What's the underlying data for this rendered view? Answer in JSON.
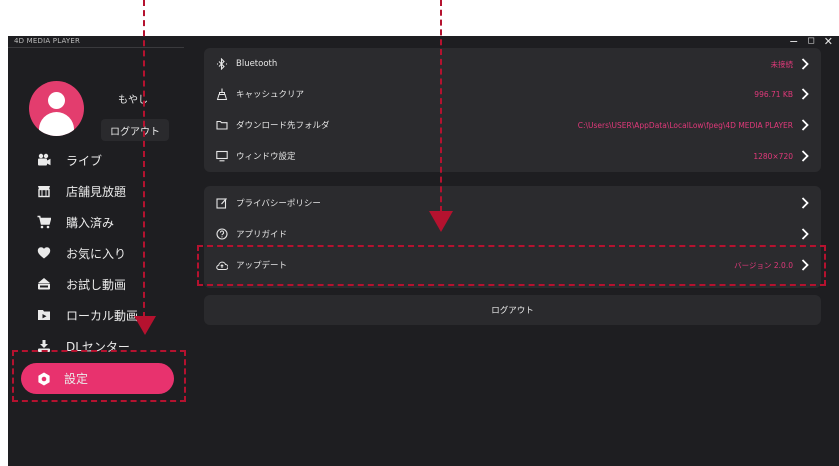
{
  "app": {
    "title": "4D MEDIA PLAYER"
  },
  "window_controls": {
    "minimize": "−",
    "maximize": "◻",
    "close": "✕"
  },
  "user": {
    "name": "もやし",
    "logout_label": "ログアウト"
  },
  "sidebar": {
    "items": [
      {
        "label": "ライブ",
        "icon": "live-camera-icon"
      },
      {
        "label": "店舗見放題",
        "icon": "store-icon"
      },
      {
        "label": "購入済み",
        "icon": "cart-icon"
      },
      {
        "label": "お気に入り",
        "icon": "heart-icon"
      },
      {
        "label": "お試し動画",
        "icon": "trial-icon"
      },
      {
        "label": "ローカル動画",
        "icon": "folder-play-icon"
      },
      {
        "label": "DLセンター",
        "icon": "download-icon"
      },
      {
        "label": "設定",
        "icon": "gear-icon",
        "active": true
      }
    ]
  },
  "settings": {
    "group1": [
      {
        "label": "Bluetooth",
        "value": "未接続",
        "icon": "bluetooth-icon"
      },
      {
        "label": "キャッシュクリア",
        "value": "996.71 KB",
        "icon": "broom-icon"
      },
      {
        "label": "ダウンロード先フォルダ",
        "value": "C:\\Users\\USER\\AppData\\LocalLow\\fpeg\\4D MEDIA PLAYER",
        "icon": "folder-icon"
      },
      {
        "label": "ウィンドウ設定",
        "value": "1280×720",
        "icon": "monitor-icon"
      }
    ],
    "group2": [
      {
        "label": "プライバシーポリシー",
        "value": "",
        "icon": "edit-icon"
      },
      {
        "label": "アプリガイド",
        "value": "",
        "icon": "help-icon"
      },
      {
        "label": "アップデート",
        "value": "バージョン 2.0.0",
        "icon": "update-icon"
      }
    ],
    "logout_label": "ログアウト"
  },
  "colors": {
    "accent": "#e8326e",
    "annotation": "#b5122f",
    "background": "#1e1e21"
  }
}
